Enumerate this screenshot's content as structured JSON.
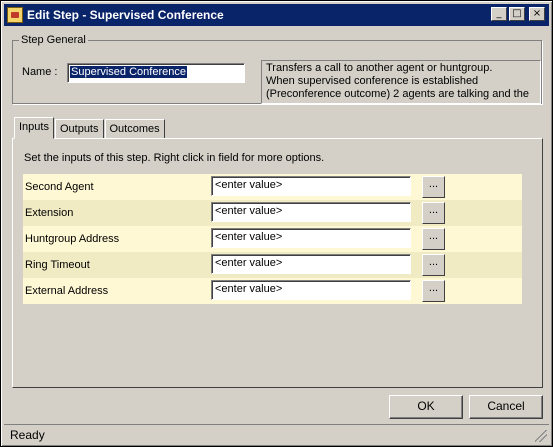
{
  "window": {
    "title": "Edit Step - Supervised Conference",
    "buttons": [
      "_",
      "□",
      "×"
    ]
  },
  "step_general": {
    "legend": "Step General",
    "name_label": "Name :",
    "name_value": "Supervised Conference",
    "description": "Transfers a call to another agent or huntgroup.\nWhen supervised conference is established\n(Preconference outcome) 2 agents are talking and the"
  },
  "tabs": [
    "Inputs",
    "Outputs",
    "Outcomes"
  ],
  "active_tab": "Inputs",
  "inputs_panel": {
    "hint": "Set the inputs of this step.  Right click in field for more options.",
    "browse_label": "...",
    "rows": [
      {
        "label": "Second Agent",
        "value": "<enter value>"
      },
      {
        "label": "Extension",
        "value": "<enter value>"
      },
      {
        "label": "Huntgroup Address",
        "value": "<enter value>"
      },
      {
        "label": "Ring Timeout",
        "value": "<enter value>"
      },
      {
        "label": "External Address",
        "value": "<enter value>"
      }
    ]
  },
  "footer": {
    "ok_label": "OK",
    "cancel_label": "Cancel"
  },
  "status": {
    "text": "Ready"
  },
  "colors": {
    "titlebar": "#0a246a",
    "face": "#d4d0c8",
    "row_light": "#fff8d4",
    "row_dark": "#f1ebc4"
  }
}
